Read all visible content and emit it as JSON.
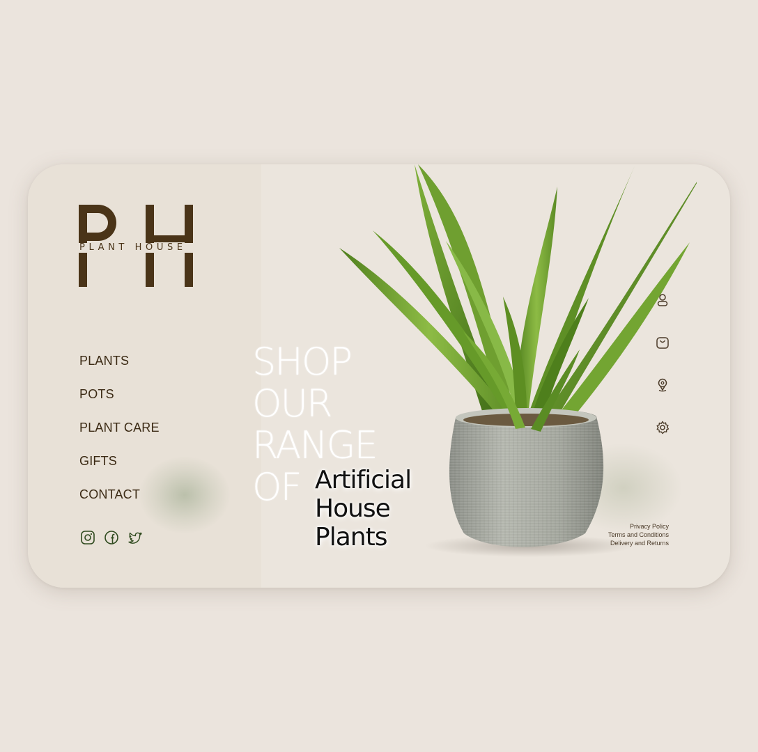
{
  "brand": {
    "monogram": "PH",
    "name": "PLANT HOUSE",
    "color": "#4a3418"
  },
  "nav": {
    "items": [
      {
        "label": "PLANTS"
      },
      {
        "label": "POTS"
      },
      {
        "label": "PLANT CARE"
      },
      {
        "label": "GIFTS"
      },
      {
        "label": "CONTACT"
      }
    ]
  },
  "social": [
    "instagram-icon",
    "facebook-icon",
    "twitter-icon"
  ],
  "hero": {
    "headline_lines": [
      "SHOP",
      "OUR",
      "RANGE",
      "OF"
    ],
    "sub_lines": [
      "Artificial",
      "House",
      "Plants"
    ]
  },
  "right_icons": [
    "user-icon",
    "bag-icon",
    "location-icon",
    "settings-icon"
  ],
  "footer": {
    "links": [
      "Privacy Policy",
      "Terms and Conditions",
      "Delivery and Returns"
    ]
  },
  "colors": {
    "background": "#ebe4dd",
    "card": "#ebe5dd",
    "text_dark": "#3b2a14",
    "leaf_green": "#6a9a2c",
    "pot_grey": "#9a9d94"
  }
}
